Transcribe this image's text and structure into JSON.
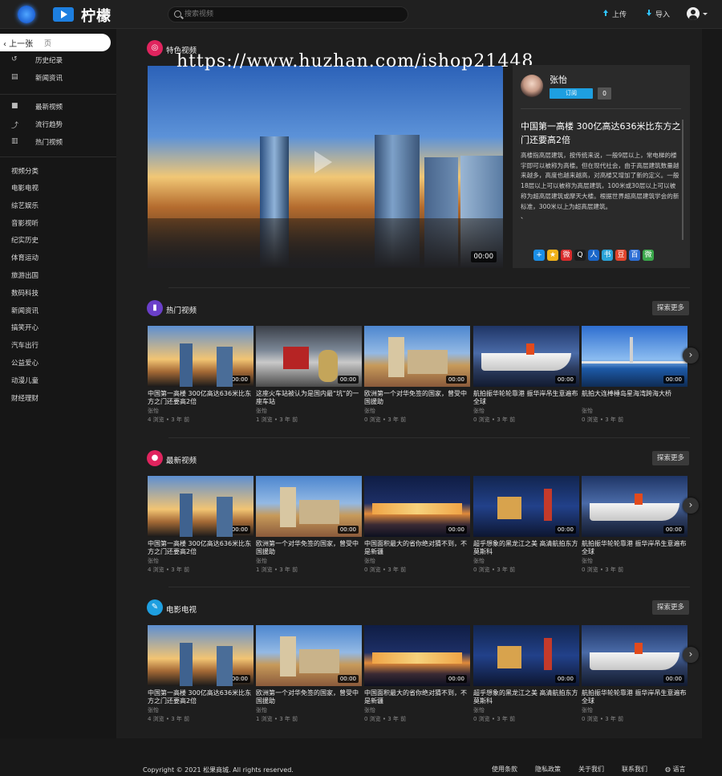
{
  "header": {
    "logo_text": "柠檬",
    "search_placeholder": "搜索视频",
    "upload_label": "上传",
    "import_label": "导入"
  },
  "sidebar": {
    "prev_label": "‹ 上一张",
    "home_label": "页",
    "nav_items": [
      {
        "label": "历史纪录",
        "icon": "history-icon"
      },
      {
        "label": "新闻资讯",
        "icon": "news-icon"
      },
      {
        "label": "最新视频",
        "icon": "video-camera-icon"
      },
      {
        "label": "流行趋势",
        "icon": "trend-icon"
      },
      {
        "label": "热门视频",
        "icon": "bar-chart-icon"
      }
    ],
    "category_heading": "视频分类",
    "categories": [
      "电影电视",
      "综艺娱乐",
      "音影视听",
      "纪实历史",
      "体育运动",
      "旅游出国",
      "数码科技",
      "新闻资讯",
      "搞笑开心",
      "汽车出行",
      "公益爱心",
      "动漫儿童",
      "财经理财"
    ]
  },
  "watermark": "https://www.huzhan.com/ishop21448",
  "featured": {
    "section_title": "特色视频",
    "duration": "00:00",
    "author": "张怡",
    "subscribe_label": "订阅",
    "subscriber_count": "0",
    "title": "中国第一高楼 300亿高达636米比东方之门还要高2倍",
    "description": "高楼指高层建筑，按传统来说，一般9层以上，常电梯的楼宇即可以被称为高楼。但在现代社会，由于高层建筑数量越来越多，高度也越来越高，对高楼又增加了新的定义。一般18层以上可以被称为高层建筑，100米或30层以上可以被称为超高层建筑或摩天大楼。根据世界超高层建筑学会的新标准，300米以上为超高层建筑。",
    "description_tail": "、",
    "share_icons": [
      {
        "name": "share-plus-icon",
        "color": "#1b8ee6",
        "glyph": "+"
      },
      {
        "name": "share-star-icon",
        "color": "#f2b21a",
        "glyph": "★"
      },
      {
        "name": "share-weibo-icon",
        "color": "#d92b2b",
        "glyph": "微"
      },
      {
        "name": "share-qq-icon",
        "color": "#1c1c1c",
        "glyph": "Q"
      },
      {
        "name": "share-renren-icon",
        "color": "#1a66c9",
        "glyph": "人"
      },
      {
        "name": "share-bookmark-icon",
        "color": "#2aa3d8",
        "glyph": "书"
      },
      {
        "name": "share-douban-icon",
        "color": "#e0442c",
        "glyph": "豆"
      },
      {
        "name": "share-baidu-icon",
        "color": "#2d6fd6",
        "glyph": "百"
      },
      {
        "name": "share-wechat-icon",
        "color": "#3aa84b",
        "glyph": "微"
      }
    ]
  },
  "sections": [
    {
      "title": "热门视频",
      "icon_color": "#6a3fc9",
      "more_label": "探索更多",
      "videos": [
        {
          "title": "中国第一高楼 300亿高达636米比东方之门还要高2倍",
          "author": "张怡",
          "meta": "4 浏览 • 3 年 前",
          "thumb": "t-city",
          "duration": "00:00"
        },
        {
          "title": "这座火车站被认为是国内最“坑”的一座车站",
          "author": "张怡",
          "meta": "1 浏览 • 3 年 前",
          "thumb": "t-station",
          "duration": "00:00"
        },
        {
          "title": "欧洲第一个对华免签的国家，曾受中国援助",
          "author": "张怡",
          "meta": "0 浏览 • 3 年 前",
          "thumb": "t-castle",
          "duration": "00:00"
        },
        {
          "title": "航拍振华轮轮靠港 振华岸吊生意遍布全球",
          "author": "张怡",
          "meta": "0 浏览 • 3 年 前",
          "thumb": "t-ship",
          "duration": "00:00"
        },
        {
          "title": "航拍大连棒棰岛星海湾跨海大桥",
          "author": "张怡",
          "meta": "0 浏览 • 3 年 前",
          "thumb": "t-bridge",
          "duration": "00:00"
        }
      ]
    },
    {
      "title": "最新视频",
      "icon_color": "#e0245e",
      "more_label": "探索更多",
      "videos": [
        {
          "title": "中国第一高楼 300亿高达636米比东方之门还要高2倍",
          "author": "张怡",
          "meta": "4 浏览 • 3 年 前",
          "thumb": "t-city",
          "duration": "00:00"
        },
        {
          "title": "欧洲第一个对华免签的国家，曾受中国援助",
          "author": "张怡",
          "meta": "1 浏览 • 3 年 前",
          "thumb": "t-castle",
          "duration": "00:00"
        },
        {
          "title": "中国面积最大的省你绝对猜不到，不是新疆",
          "author": "张怡",
          "meta": "0 浏览 • 3 年 前",
          "thumb": "t-night",
          "duration": "00:00"
        },
        {
          "title": "超乎想象的黑龙江之美 高清航拍东方莫斯科",
          "author": "张怡",
          "meta": "0 浏览 • 3 年 前",
          "thumb": "t-kremlin",
          "duration": "00:00"
        },
        {
          "title": "航拍振华轮轮靠港 振华岸吊生意遍布全球",
          "author": "张怡",
          "meta": "0 浏览 • 3 年 前",
          "thumb": "t-ship",
          "duration": "00:00"
        }
      ]
    },
    {
      "title": "电影电视",
      "icon_color": "#1e9fe0",
      "more_label": "探索更多",
      "videos": [
        {
          "title": "中国第一高楼 300亿高达636米比东方之门还要高2倍",
          "author": "张怡",
          "meta": "4 浏览 • 3 年 前",
          "thumb": "t-city",
          "duration": "00:00"
        },
        {
          "title": "欧洲第一个对华免签的国家，曾受中国援助",
          "author": "张怡",
          "meta": "1 浏览 • 3 年 前",
          "thumb": "t-castle",
          "duration": "00:00"
        },
        {
          "title": "中国面积最大的省你绝对猜不到，不是新疆",
          "author": "张怡",
          "meta": "0 浏览 • 3 年 前",
          "thumb": "t-night",
          "duration": "00:00"
        },
        {
          "title": "超乎想象的黑龙江之美 高清航拍东方莫斯科",
          "author": "张怡",
          "meta": "0 浏览 • 3 年 前",
          "thumb": "t-kremlin",
          "duration": "00:00"
        },
        {
          "title": "航拍振华轮轮靠港 振华岸吊生意遍布全球",
          "author": "张怡",
          "meta": "0 浏览 • 3 年 前",
          "thumb": "t-ship",
          "duration": "00:00"
        }
      ]
    }
  ],
  "footer": {
    "copyright": "Copyright © 2021 松果商城. All rights reserved.",
    "links": [
      "使用条款",
      "隐私政策",
      "关于我们",
      "联系我们",
      "语言"
    ]
  }
}
